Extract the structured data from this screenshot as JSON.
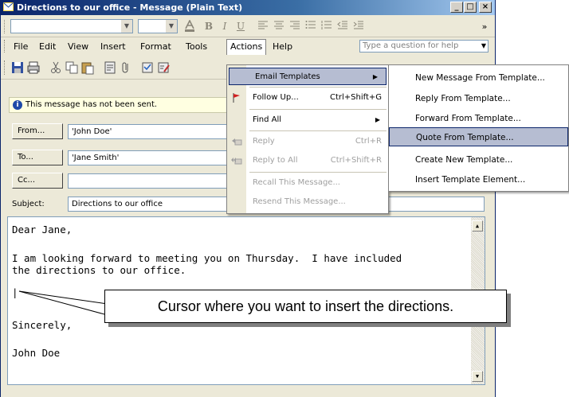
{
  "window": {
    "title": "Directions to our office - Message (Plain Text)",
    "buttons": {
      "minimize": "_",
      "maximize": "□",
      "close": "×"
    }
  },
  "format_toolbar": {
    "overflow": "»"
  },
  "menubar": {
    "items": [
      "File",
      "Edit",
      "View",
      "Insert",
      "Format",
      "Tools",
      "Actions",
      "Help"
    ],
    "active": "Actions",
    "help_placeholder": "Type a question for help"
  },
  "infobar": {
    "text": "This message has not been sent."
  },
  "fields": {
    "from": {
      "label": "From...",
      "value": "'John Doe'"
    },
    "to": {
      "label": "To...",
      "value": "'Jane Smith'"
    },
    "cc": {
      "label": "Cc...",
      "value": ""
    },
    "subject": {
      "label": "Subject:",
      "value": "Directions to our office"
    }
  },
  "body": {
    "lines": [
      "Dear Jane,",
      "",
      "I am looking forward to meeting you on Thursday.  I have included",
      "the directions to our office.",
      "",
      "|",
      "",
      "Sincerely,",
      "",
      "John Doe"
    ]
  },
  "actions_menu": {
    "items": [
      {
        "label": "Email Templates",
        "shortcut": "",
        "submenu": true,
        "selected": true,
        "disabled": false
      },
      {
        "label": "Follow Up...",
        "shortcut": "Ctrl+Shift+G",
        "submenu": false,
        "selected": false,
        "disabled": false
      },
      {
        "label": "Find All",
        "shortcut": "",
        "submenu": true,
        "selected": false,
        "disabled": false
      },
      {
        "label": "Reply",
        "shortcut": "Ctrl+R",
        "submenu": false,
        "selected": false,
        "disabled": true
      },
      {
        "label": "Reply to All",
        "shortcut": "Ctrl+Shift+R",
        "submenu": false,
        "selected": false,
        "disabled": true
      },
      {
        "label": "Recall This Message...",
        "shortcut": "",
        "submenu": false,
        "selected": false,
        "disabled": true
      },
      {
        "label": "Resend This Message...",
        "shortcut": "",
        "submenu": false,
        "selected": false,
        "disabled": true
      }
    ]
  },
  "templates_menu": {
    "items": [
      {
        "label": "New Message From Template...",
        "selected": false
      },
      {
        "label": "Reply From Template...",
        "selected": false
      },
      {
        "label": "Forward From Template...",
        "selected": false
      },
      {
        "label": "Quote From Template...",
        "selected": true
      },
      {
        "label": "Create New Template...",
        "selected": false
      },
      {
        "label": "Insert Template Element...",
        "selected": false
      }
    ]
  },
  "callout": {
    "text": "Cursor where you want to insert the directions."
  },
  "colors": {
    "title_start": "#0a246a",
    "title_end": "#a6caf0",
    "menu_highlight": "#b6bdd2",
    "window_bg": "#ece9d8",
    "info_bg": "#ffffe1"
  }
}
